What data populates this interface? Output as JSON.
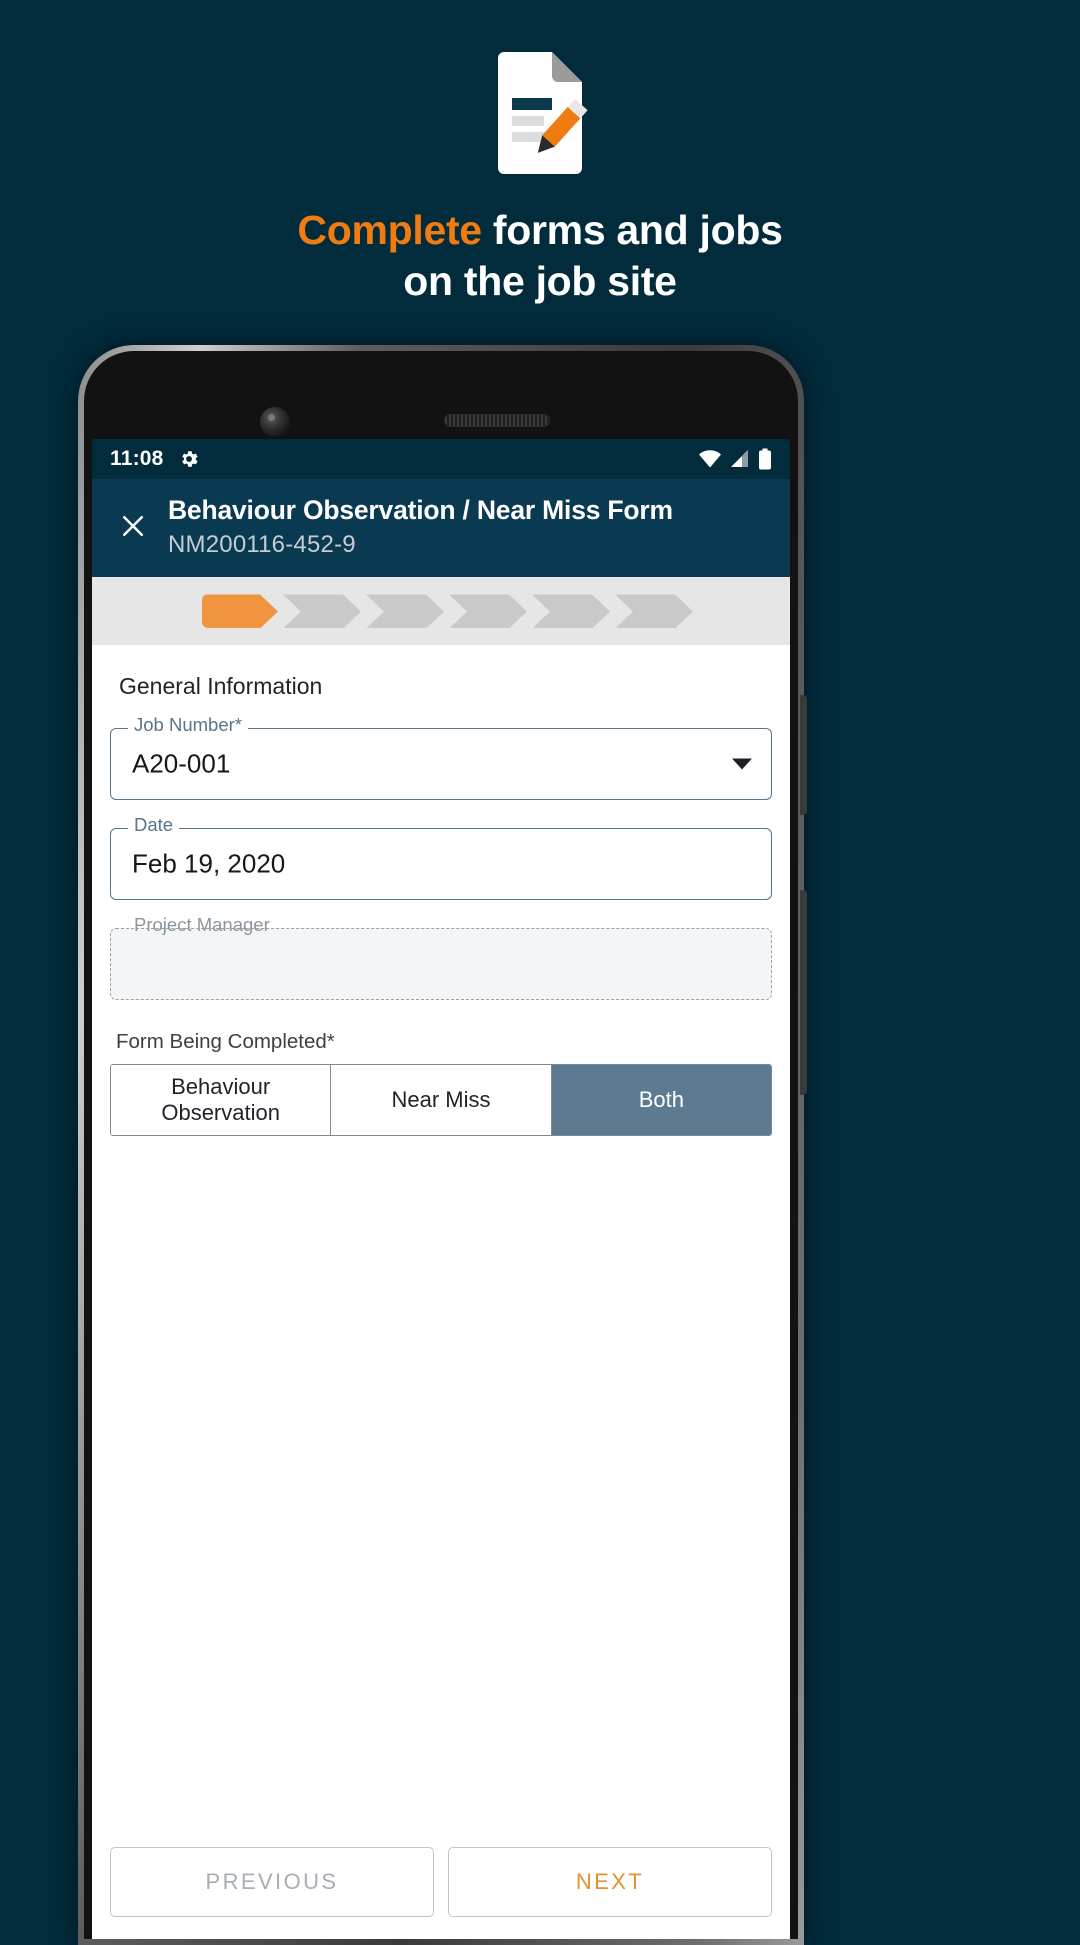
{
  "promo": {
    "icon_name": "document-with-pencil-icon",
    "headline_accent": "Complete",
    "headline_rest": " forms and jobs",
    "headline_line2": "on the job site",
    "colors": {
      "background": "#022B3C",
      "accent": "#F07B10",
      "text": "#FFFFFF"
    }
  },
  "phone": {
    "camera_icon": "front-camera-icon",
    "speaker_icon": "earpiece-speaker-icon"
  },
  "statusbar": {
    "time": "11:08",
    "gear_icon": "gear-icon",
    "wifi_icon": "wifi-icon",
    "signal_icon": "cellular-signal-icon",
    "battery_icon": "battery-full-icon"
  },
  "appbar": {
    "close_icon": "close-icon",
    "title": "Behaviour Observation / Near Miss Form",
    "subtitle": "NM200116-452-9",
    "background": "#0A3A52"
  },
  "stepper": {
    "total_steps": 6,
    "active_step": 1,
    "active_color": "#F0943F",
    "inactive_color": "#C9C9C9",
    "track_color": "#E6E6E6"
  },
  "form": {
    "section_title": "General Information",
    "fields": [
      {
        "label": "Job Number*",
        "value": "A20-001",
        "type": "dropdown",
        "enabled": true,
        "dropdown_icon": "chevron-down-icon"
      },
      {
        "label": "Date",
        "value": "Feb 19, 2020",
        "type": "text",
        "enabled": true
      },
      {
        "label": "Project Manager",
        "value": "",
        "type": "text",
        "enabled": false
      }
    ],
    "segmented_label": "Form Being Completed*",
    "segmented_options": [
      {
        "label": "Behaviour Observation",
        "selected": false
      },
      {
        "label": "Near Miss",
        "selected": false
      },
      {
        "label": "Both",
        "selected": true
      }
    ],
    "selected_color": "#5D7A91"
  },
  "footer": {
    "previous_label": "PREVIOUS",
    "next_label": "NEXT",
    "previous_color": "#A8AEB3",
    "next_color": "#E2922F"
  }
}
